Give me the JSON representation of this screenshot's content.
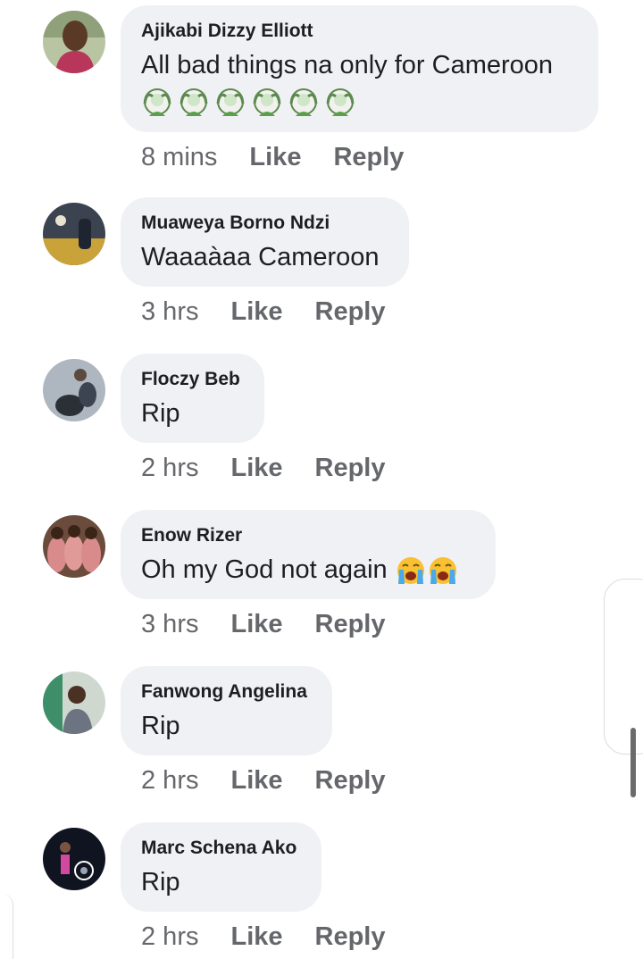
{
  "comments": [
    {
      "author": "Ajikabi Dizzy Elliott",
      "text": "All bad things na only for Cameroon",
      "emoji_row": [
        "face-palm-emoji",
        "face-palm-emoji",
        "face-palm-emoji",
        "face-palm-emoji",
        "face-palm-emoji",
        "face-palm-emoji"
      ],
      "time": "8 mins",
      "like_label": "Like",
      "reply_label": "Reply"
    },
    {
      "author": "Muaweya Borno Ndzi",
      "text": "Waaaàaa Cameroon",
      "time": "3 hrs",
      "like_label": "Like",
      "reply_label": "Reply"
    },
    {
      "author": "Floczy Beb",
      "text": "Rip",
      "time": "2 hrs",
      "like_label": "Like",
      "reply_label": "Reply"
    },
    {
      "author": "Enow Rizer",
      "text": "Oh my God not again",
      "inline_emoji": [
        "loudly-crying-face-emoji",
        "loudly-crying-face-emoji"
      ],
      "time": "3 hrs",
      "like_label": "Like",
      "reply_label": "Reply"
    },
    {
      "author": "Fanwong Angelina",
      "text": "Rip",
      "time": "2 hrs",
      "like_label": "Like",
      "reply_label": "Reply"
    },
    {
      "author": "Marc Schena Ako",
      "text": "Rip",
      "time": "2 hrs",
      "like_label": "Like",
      "reply_label": "Reply"
    }
  ],
  "colors": {
    "bubble_bg": "#f0f1f4",
    "name_text": "#1c1e21",
    "meta_text": "#65676b",
    "emoji_yellow": "#f7c133",
    "emoji_tears": "#4aa9e8",
    "emoji_skin": "#cfe6c9"
  }
}
